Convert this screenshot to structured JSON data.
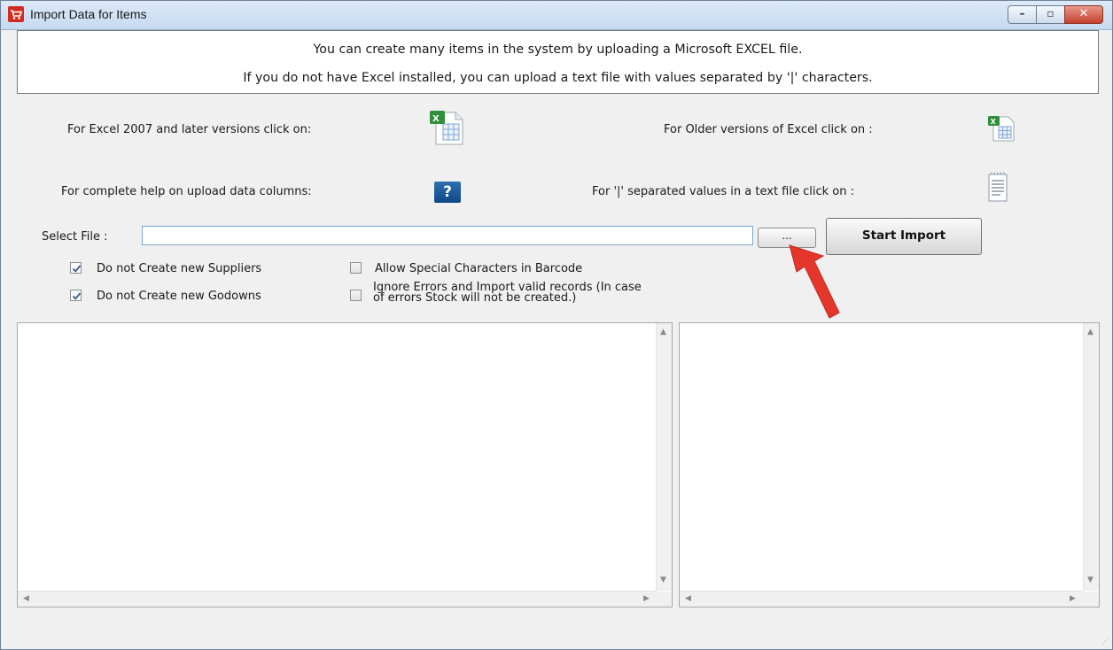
{
  "window": {
    "title": "Import Data for Items",
    "icons": {
      "app": "shopping-cart-icon",
      "minimize": "minimize-icon",
      "maximize": "maximize-icon",
      "close": "close-icon"
    },
    "minimize_glyph": "–",
    "maximize_glyph": "▫",
    "close_glyph": "✕"
  },
  "info": {
    "line1": "You can create many items in the system by uploading a Microsoft EXCEL file.",
    "line2": "If you do not have Excel installed, you can upload a text file with values separated by '|' characters."
  },
  "options": {
    "excel2007_label": "For Excel 2007 and later versions click on:",
    "older_excel_label": "For Older versions of Excel click on :",
    "help_label": "For complete help on upload data columns:",
    "help_glyph": "?",
    "text_file_label": "For '|' separated  values in a text file click on :",
    "icons": {
      "excel2007": "excel-xlsx-icon",
      "older_excel": "excel-xls-icon",
      "help": "help-question-icon",
      "text_file": "text-file-icon"
    }
  },
  "file_select": {
    "label": "Select File :",
    "value": "",
    "browse_label": "...",
    "start_label": "Start Import"
  },
  "checkboxes": [
    {
      "label": "Do not Create new Suppliers",
      "checked": true
    },
    {
      "label": "Do not Create new Godowns",
      "checked": true
    },
    {
      "label": "Allow Special Characters in Barcode",
      "checked": false
    },
    {
      "label_line1": "Ignore Errors and Import valid records (In case",
      "label_line2": "of errors Stock will not be created.)",
      "checked": false
    }
  ],
  "colors": {
    "annotation_arrow": "#e5362b",
    "title_bar": "#c7daf1",
    "close_button": "#c6412e",
    "help_button": "#0d4985"
  }
}
